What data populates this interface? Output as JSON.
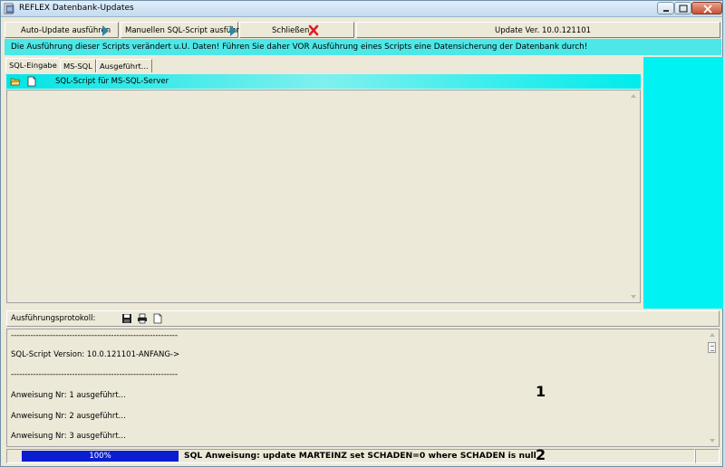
{
  "window": {
    "title": "REFLEX Datenbank-Updates"
  },
  "toolbar": {
    "auto_update_label": "Auto-Update ausführen",
    "manual_script_label": "Manuellen SQL-Script ausführen",
    "close_label": "Schließen",
    "version_label": "Update Ver. 10.0.121101"
  },
  "warning_text": "Die Ausführung dieser Scripts verändert u.U. Daten! Führen Sie daher VOR Ausführung eines Scripts eine Datensicherung der Datenbank durch!",
  "tabs": [
    {
      "label": "SQL-Eingabe",
      "active": true
    },
    {
      "label": "MS-SQL",
      "active": false
    },
    {
      "label": "Ausgeführt...",
      "active": false
    }
  ],
  "script_header": {
    "title": "SQL-Script für MS-SQL-Server"
  },
  "log": {
    "title": "Ausführungsprotokoll:",
    "lines": [
      "------------------------------------------------------------",
      "SQL-Script Version: 10.0.121101-ANFANG->",
      "------------------------------------------------------------",
      "Anweisung Nr: 1 ausgeführt...",
      "Anweisung Nr: 2 ausgeführt...",
      "Anweisung Nr: 3 ausgeführt..."
    ]
  },
  "status": {
    "progress_percent": 100,
    "progress_label": "100%",
    "text": "SQL Anweisung: update MARTEINZ set SCHADEN=0 where SCHADEN is null"
  },
  "markers": [
    "1",
    "2"
  ],
  "colors": {
    "warning_bg": "#4de7e7",
    "panel_cyan": "#00f2f2",
    "progress_fill": "#0a1ed0",
    "arrow": "#2a88a8",
    "close_x": "#e02020"
  }
}
